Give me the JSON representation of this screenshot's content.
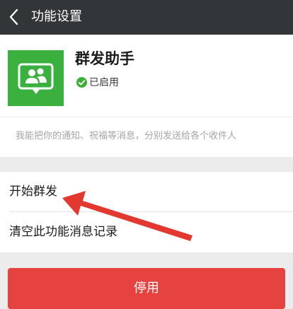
{
  "header": {
    "title": "功能设置",
    "back_icon": "chevron-left-icon",
    "background_color": "#333639"
  },
  "feature": {
    "name": "群发助手",
    "icon": "group-chat-icon",
    "icon_color": "#3ab03f",
    "status_icon": "check-circle-icon",
    "status": "已启用",
    "description": "我能把你的通知、祝福等消息，分别发送给各个收件人"
  },
  "menu": {
    "items": [
      {
        "label": "开始群发"
      },
      {
        "label": "清空此功能消息记录"
      }
    ]
  },
  "actions": {
    "disable_label": "停用",
    "disable_color": "#e64340"
  },
  "annotation": {
    "arrow_color": "#e2382f",
    "arrow_points_to": "开始群发"
  }
}
